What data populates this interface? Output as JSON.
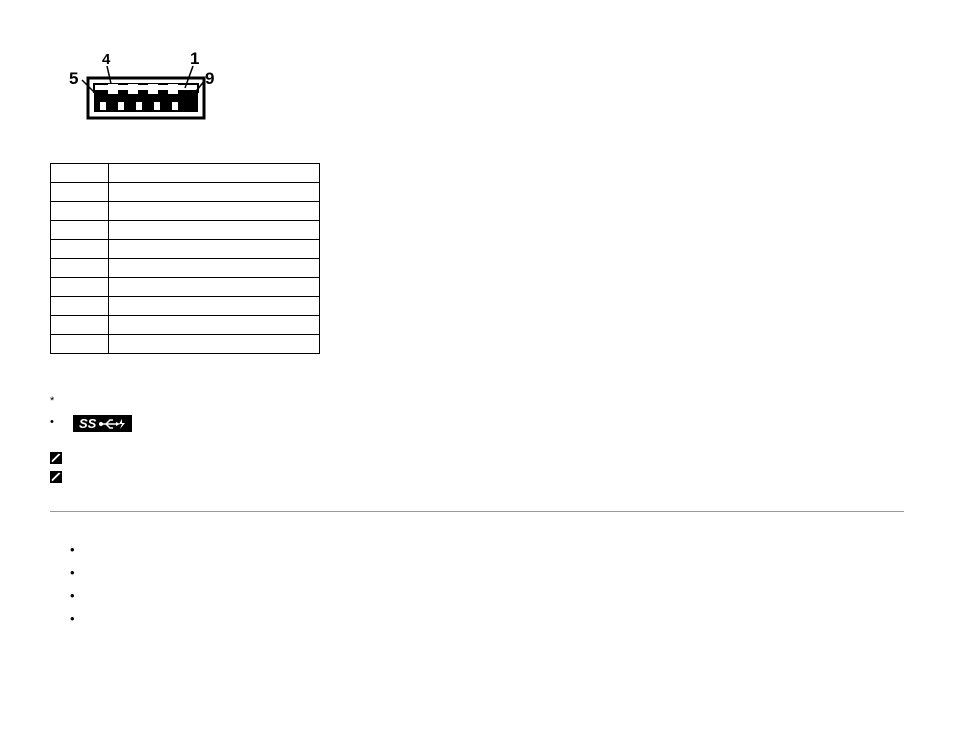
{
  "connector": {
    "label_top_left": "4",
    "label_top_right": "1",
    "label_left": "5",
    "label_right": "9"
  },
  "table": {
    "rows": [
      {
        "pin": "",
        "signal": ""
      },
      {
        "pin": "",
        "signal": ""
      },
      {
        "pin": "",
        "signal": ""
      },
      {
        "pin": "",
        "signal": ""
      },
      {
        "pin": "",
        "signal": ""
      },
      {
        "pin": "",
        "signal": ""
      },
      {
        "pin": "",
        "signal": ""
      },
      {
        "pin": "",
        "signal": ""
      },
      {
        "pin": "",
        "signal": ""
      },
      {
        "pin": "",
        "signal": ""
      }
    ]
  },
  "note1": "",
  "note2_pre": "",
  "note2_post": "",
  "pencil_note1": "",
  "pencil_note2": "",
  "section": {
    "title": "",
    "intro": "",
    "bullets": [
      "",
      "",
      "",
      ""
    ]
  }
}
